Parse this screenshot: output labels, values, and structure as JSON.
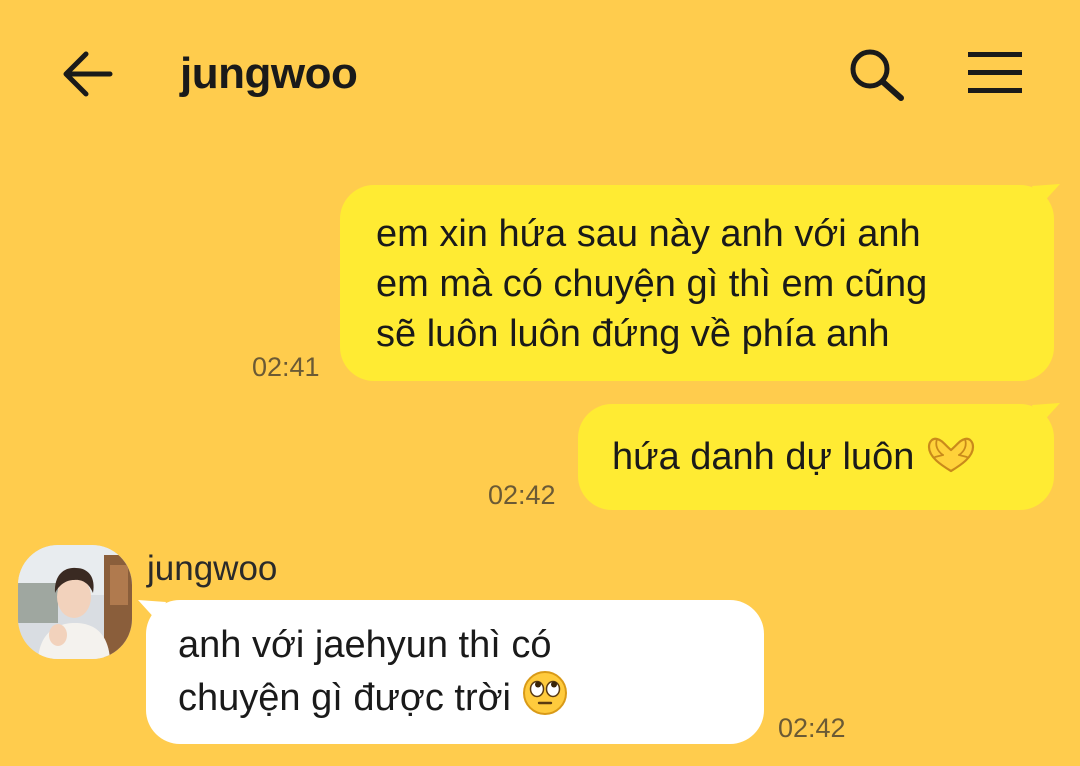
{
  "header": {
    "title": "jungwoo",
    "back_icon": "arrow-left-icon",
    "search_icon": "search-icon",
    "menu_icon": "hamburger-menu-icon"
  },
  "messages": [
    {
      "direction": "sent",
      "lines": [
        "em xin hứa sau này anh với anh",
        "em mà có chuyện gì thì em cũng",
        "sẽ luôn luôn đứng về phía anh"
      ],
      "time": "02:41"
    },
    {
      "direction": "sent",
      "text": "hứa danh dự luôn",
      "emoji": "heart-hands-emoji",
      "time": "02:42"
    },
    {
      "direction": "received",
      "sender": "jungwoo",
      "avatar": "profile-photo",
      "lines": [
        "anh với jaehyun thì có",
        "chuyện gì được trời"
      ],
      "emoji": "eye-roll-emoji",
      "time": "02:42"
    }
  ],
  "colors": {
    "background": "#FFCC4D",
    "sent_bubble": "#FFEB33",
    "received_bubble": "#FFFFFF"
  }
}
